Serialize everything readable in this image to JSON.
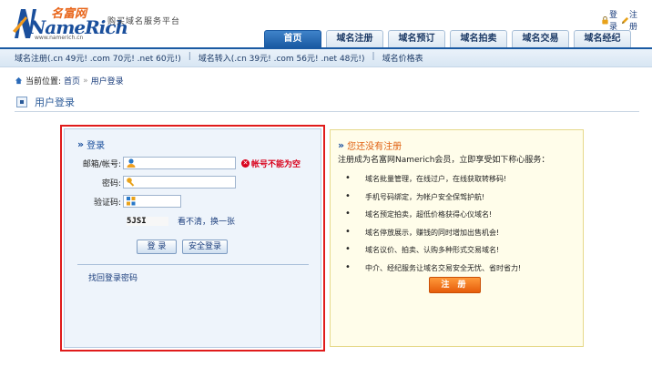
{
  "brand": {
    "logo_main": "NameRich",
    "logo_cn": "名富网",
    "logo_url": "www.namerich.cn",
    "slogan": "购买域名服务平台"
  },
  "top_links": {
    "login": "登录",
    "register": "注册"
  },
  "nav": {
    "tabs": [
      {
        "label": "首页",
        "active": true
      },
      {
        "label": "域名注册"
      },
      {
        "label": "域名预订"
      },
      {
        "label": "域名拍卖"
      },
      {
        "label": "域名交易"
      },
      {
        "label": "域名经纪"
      }
    ]
  },
  "subbar": {
    "items": [
      "域名注册(.cn 49元! .com 70元! .net 60元!)",
      "域名转入(.cn 39元! .com 56元! .net 48元!)",
      "域名价格表"
    ],
    "separator": "|"
  },
  "breadcrumb": {
    "prefix": "当前位置:",
    "home": "首页",
    "sep": "»",
    "current": "用户登录"
  },
  "page_title": "用户登录",
  "login": {
    "title": "登录",
    "email_label": "邮箱/帐号:",
    "email_value": "",
    "email_error": "帐号不能为空",
    "password_label": "密码:",
    "captcha_label": "验证码:",
    "captcha_text": "5JSI",
    "captcha_refresh": "看不清，换一张",
    "login_button": "登 录",
    "secure_login_button": "安全登录",
    "forgot_password": "找回登录密码"
  },
  "register": {
    "title": "您还没有注册",
    "description": "注册成为名富网Namerich会员，立即享受如下称心服务：",
    "benefits": [
      "域名批量管理，在线过户，在线获取转移码!",
      "手机号码绑定，为帐户安全保驾护航!",
      "域名预定拍卖，超低价格获得心仪域名!",
      "域名停放展示，赚钱的同时增加出售机会!",
      "域名议价、拍卖、认购多种形式交易域名!",
      "中介、经纪服务让域名交易安全无忧、省时省力!"
    ],
    "register_button": "注 册"
  },
  "colors": {
    "brand_blue": "#1a5aa3",
    "highlight_red": "#e01b1b",
    "accent_orange": "#e65c0a"
  }
}
